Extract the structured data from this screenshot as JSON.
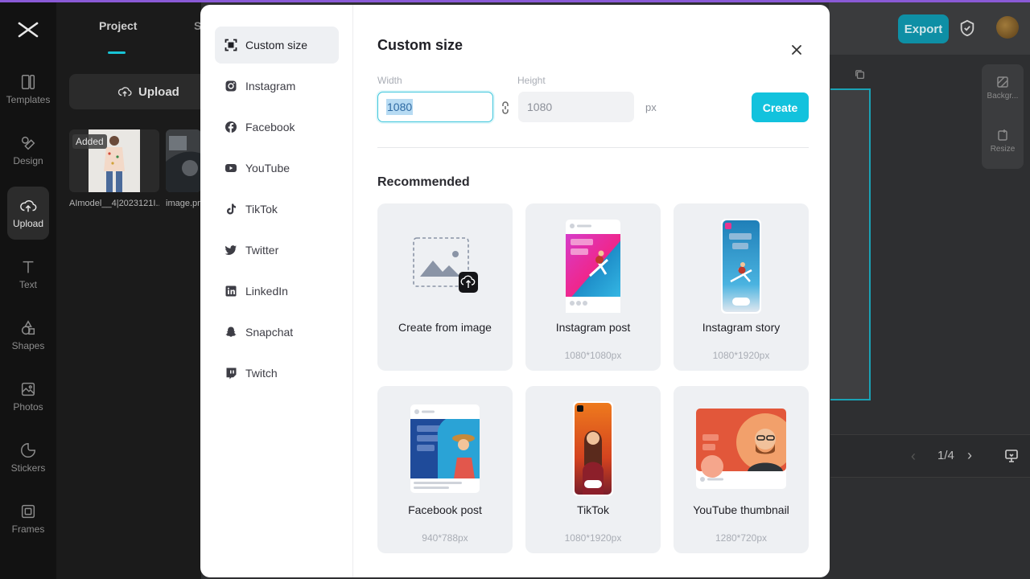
{
  "app": {
    "rail": [
      {
        "label": "Templates",
        "icon": "templates-icon"
      },
      {
        "label": "Design",
        "icon": "design-icon"
      },
      {
        "label": "Upload",
        "icon": "upload-cloud-icon",
        "active": true
      },
      {
        "label": "Text",
        "icon": "text-icon"
      },
      {
        "label": "Shapes",
        "icon": "shapes-icon"
      },
      {
        "label": "Photos",
        "icon": "photos-icon"
      },
      {
        "label": "Stickers",
        "icon": "stickers-icon"
      },
      {
        "label": "Frames",
        "icon": "frames-icon"
      }
    ],
    "panel": {
      "tab_project": "Project",
      "tab_second": "S",
      "upload_label": "Upload",
      "added_badge": "Added",
      "thumbs": [
        "AImodel__4|2023121I...",
        "image.pn"
      ]
    },
    "topbar": {
      "export_label": "Export"
    },
    "side_tools": [
      "Backgr...",
      "Resize"
    ],
    "pager": {
      "text": "1/4",
      "prev": "‹",
      "next": "›"
    }
  },
  "modal": {
    "sidebar": [
      {
        "label": "Custom size",
        "icon": "custom-size-icon",
        "active": true
      },
      {
        "label": "Instagram",
        "icon": "instagram-icon"
      },
      {
        "label": "Facebook",
        "icon": "facebook-icon"
      },
      {
        "label": "YouTube",
        "icon": "youtube-icon"
      },
      {
        "label": "TikTok",
        "icon": "tiktok-icon"
      },
      {
        "label": "Twitter",
        "icon": "twitter-icon"
      },
      {
        "label": "LinkedIn",
        "icon": "linkedin-icon"
      },
      {
        "label": "Snapchat",
        "icon": "snapchat-icon"
      },
      {
        "label": "Twitch",
        "icon": "twitch-icon"
      }
    ],
    "title": "Custom size",
    "width_label": "Width",
    "height_label": "Height",
    "width_value": "1080",
    "height_value": "1080",
    "unit": "px",
    "create_label": "Create",
    "recommended_title": "Recommended",
    "cards": [
      {
        "label": "Create from image",
        "size": ""
      },
      {
        "label": "Instagram post",
        "size": "1080*1080px"
      },
      {
        "label": "Instagram story",
        "size": "1080*1920px"
      },
      {
        "label": "Facebook post",
        "size": "940*788px"
      },
      {
        "label": "TikTok",
        "size": "1080*1920px"
      },
      {
        "label": "YouTube thumbnail",
        "size": "1280*720px"
      }
    ],
    "colors": {
      "accent": "#12c2dd",
      "focus": "#3ec6dc",
      "card_bg": "#eef0f3"
    }
  }
}
